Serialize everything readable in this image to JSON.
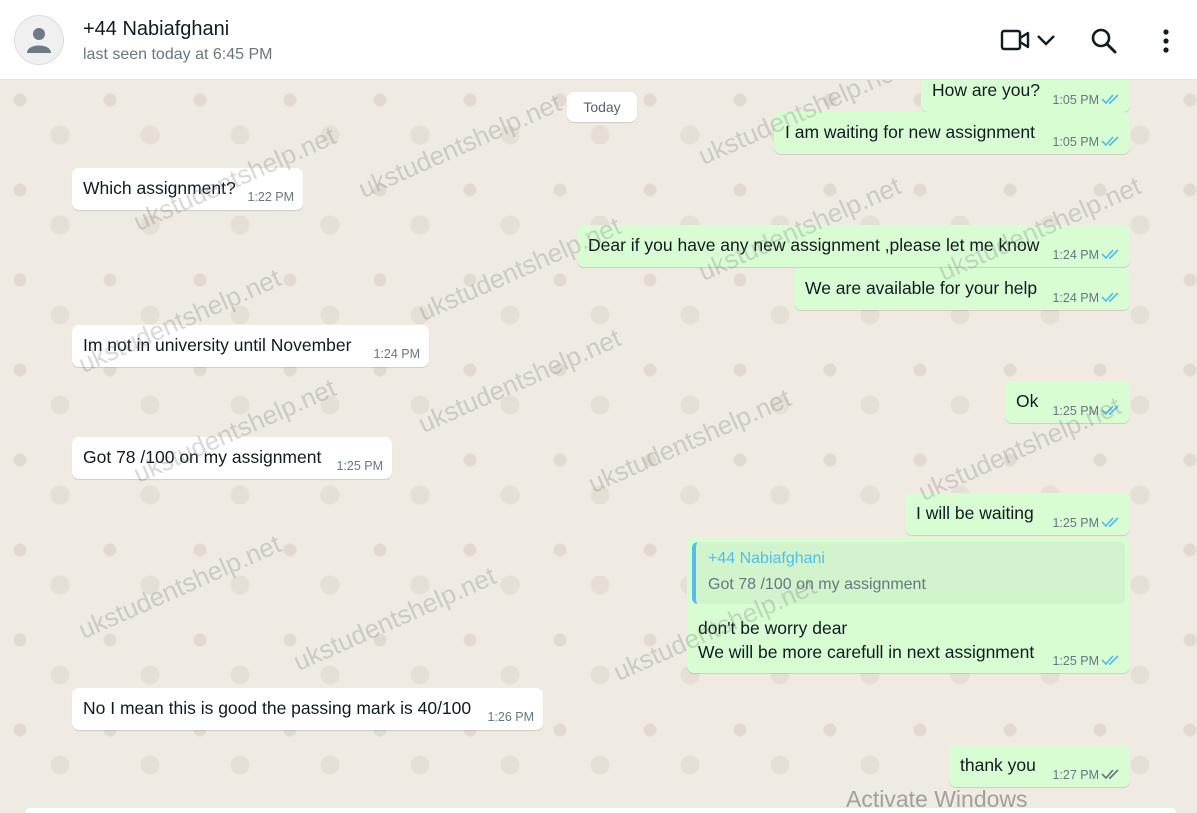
{
  "header": {
    "contact_name": "+44 Nabiafghani",
    "last_seen": "last seen today at 6:45 PM"
  },
  "icons": {
    "avatar": "person-icon",
    "video": "video-camera-icon",
    "dropdown": "chevron-down-icon",
    "search": "search-icon",
    "menu": "more-vertical-icon",
    "read": "double-check-icon"
  },
  "colors": {
    "incoming_bubble": "#ffffff",
    "outgoing_bubble": "#d9fdd3",
    "read_ticks": "#53bdeb",
    "delivered_ticks": "#667781",
    "quote_accent": "#53bdeb",
    "chat_background": "#efeae2"
  },
  "chat": {
    "date_separator": "Today",
    "messages": [
      {
        "dir": "out",
        "text": "How are you?",
        "time": "1:05 PM",
        "status": "read"
      },
      {
        "dir": "out",
        "text": "I am waiting for new assignment",
        "time": "1:05 PM",
        "status": "read"
      },
      {
        "dir": "in",
        "text": "Which assignment?",
        "time": "1:22 PM"
      },
      {
        "dir": "out",
        "text": "Dear if you have any new assignment ,please let me know",
        "time": "1:24 PM",
        "status": "read"
      },
      {
        "dir": "out",
        "text": "We are available for your help",
        "time": "1:24 PM",
        "status": "read"
      },
      {
        "dir": "in",
        "text": "Im not in university until November",
        "time": "1:24 PM"
      },
      {
        "dir": "out",
        "text": "Ok",
        "time": "1:25 PM",
        "status": "read"
      },
      {
        "dir": "in",
        "text": "Got 78 /100 on my assignment",
        "time": "1:25 PM"
      },
      {
        "dir": "out",
        "text": "I will be waiting",
        "time": "1:25 PM",
        "status": "read"
      },
      {
        "dir": "out",
        "quote_name": "+44 Nabiafghani",
        "quote_text": "Got 78 /100 on my assignment",
        "line1": "don't be worry dear",
        "line2": "We will be more carefull in next assignment",
        "time": "1:25 PM",
        "status": "read"
      },
      {
        "dir": "in",
        "text": "No I mean this is good the passing mark is 40/100",
        "time": "1:26 PM"
      },
      {
        "dir": "out",
        "text": "thank you",
        "time": "1:27 PM",
        "status": "delivered"
      }
    ]
  },
  "watermark": "ukstudentshelp.net",
  "os_overlay": "Activate Windows"
}
